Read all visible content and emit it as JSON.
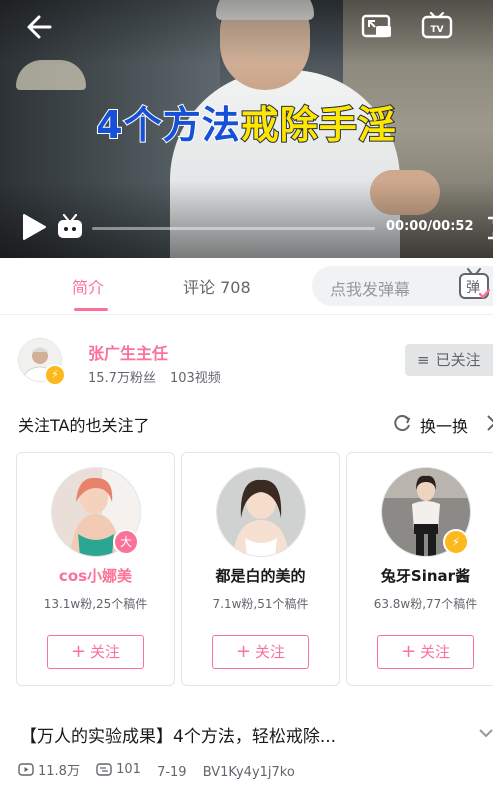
{
  "player": {
    "overlay_title_part1": "4个方法",
    "overlay_title_part2": "戒除手淫",
    "time": "00:00/00:52",
    "progress": 0.0,
    "icons": [
      "back-arrow-icon",
      "picture-in-picture-icon",
      "tv-cast-icon",
      "play-icon",
      "danmaku-tv-icon",
      "fullscreen-icon"
    ]
  },
  "tabs": {
    "intro": "简介",
    "comments": "评论 708",
    "active": "intro"
  },
  "danmaku": {
    "placeholder": "点我发弹幕",
    "button_label": "弹"
  },
  "uploader": {
    "name": "张广生主任",
    "followers": "15.7万粉丝",
    "videos": "103视频",
    "follow_state": "已关注"
  },
  "recommend": {
    "title": "关注TA的也关注了",
    "refresh_label": "换一换",
    "users": [
      {
        "name": "cos小娜美",
        "stats": "13.1w粉,25个稿件",
        "follow_label": "关注",
        "name_color": "#fb7299",
        "badge": "大",
        "badge_color": "#fb7299"
      },
      {
        "name": "都是白的美的",
        "stats": "7.1w粉,51个稿件",
        "follow_label": "关注",
        "name_color": "#18191c",
        "badge": "",
        "badge_color": ""
      },
      {
        "name": "兔牙Sinar酱",
        "stats": "63.8w粉,77个稿件",
        "follow_label": "关注",
        "name_color": "#18191c",
        "badge": "⚡",
        "badge_color": "#fbb91c"
      }
    ]
  },
  "video": {
    "title": "【万人的实验成果】4个方法，轻松戒除...",
    "views": "11.8万",
    "danmaku_count": "101",
    "date": "7-19",
    "bvid": "BV1Ky4y1j7ko"
  },
  "colors": {
    "accent": "#fb7299",
    "overlay_blue": "#1550d6",
    "overlay_yellow": "#ffe600"
  }
}
